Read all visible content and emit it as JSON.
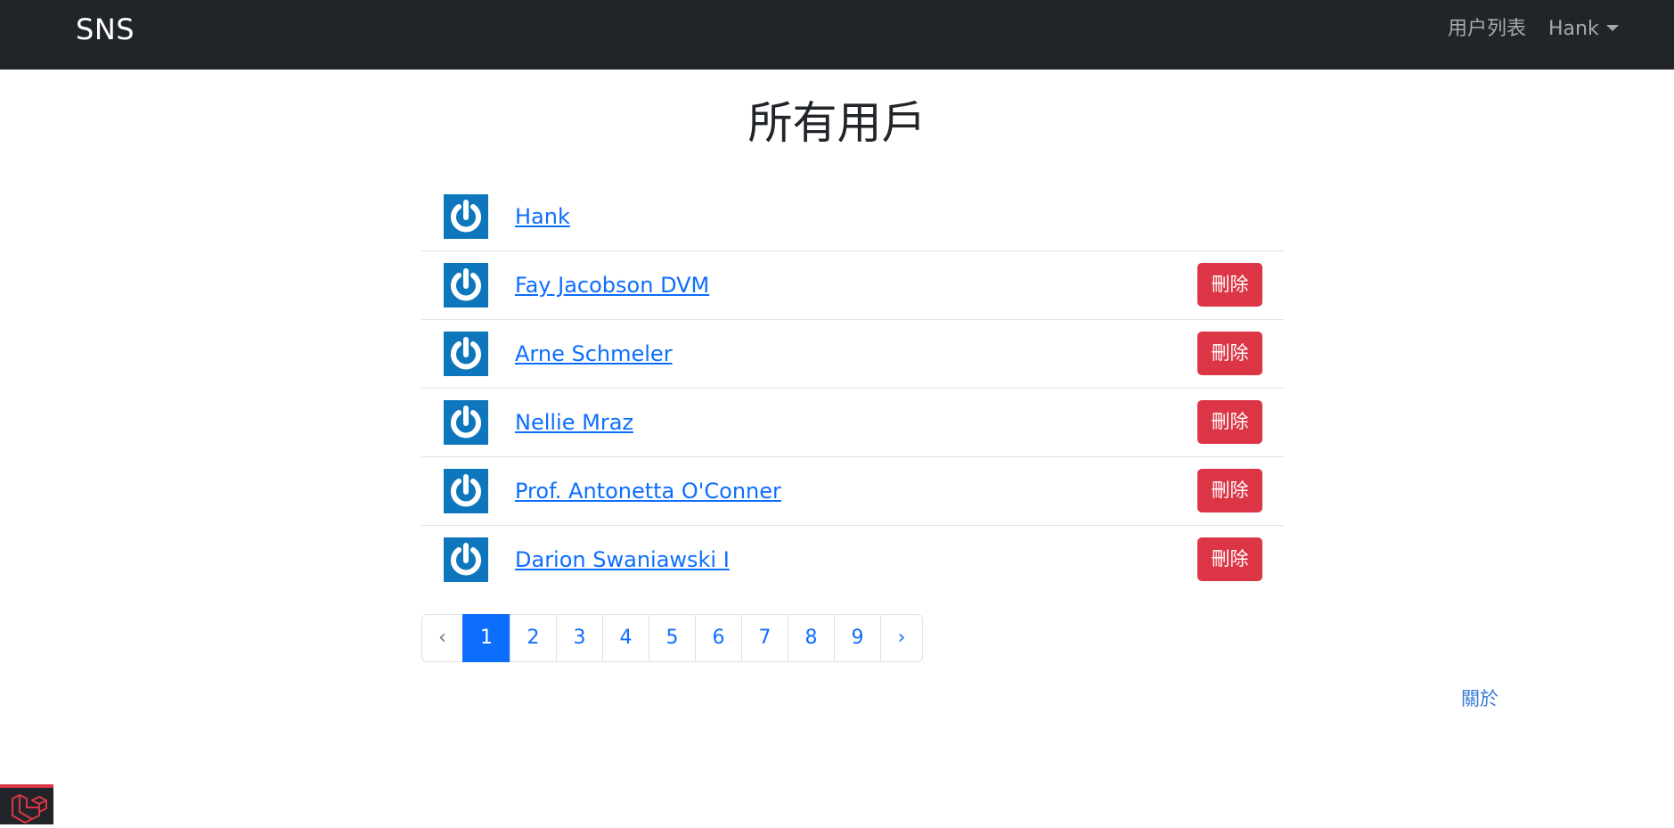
{
  "navbar": {
    "brand": "SNS",
    "users_link": "用户列表",
    "current_user": "Hank"
  },
  "page": {
    "title": "所有用戶"
  },
  "users": [
    {
      "name": "Hank",
      "delete_label": ""
    },
    {
      "name": "Fay Jacobson DVM",
      "delete_label": "刪除"
    },
    {
      "name": "Arne Schmeler",
      "delete_label": "刪除"
    },
    {
      "name": "Nellie Mraz",
      "delete_label": "刪除"
    },
    {
      "name": "Prof. Antonetta O'Conner",
      "delete_label": "刪除"
    },
    {
      "name": "Darion Swaniawski I",
      "delete_label": "刪除"
    }
  ],
  "pagination": {
    "prev": "‹",
    "pages": [
      "1",
      "2",
      "3",
      "4",
      "5",
      "6",
      "7",
      "8",
      "9"
    ],
    "active_page": "1",
    "next": "›"
  },
  "footer": {
    "about_link": "關於"
  },
  "icons": {
    "avatar": "power-icon",
    "debug_badge": "laravel-logo-icon"
  },
  "colors": {
    "navbar": "#212529",
    "danger": "#dc3545",
    "primary": "#0d6efd",
    "avatar_bg": "#0e76bc"
  }
}
